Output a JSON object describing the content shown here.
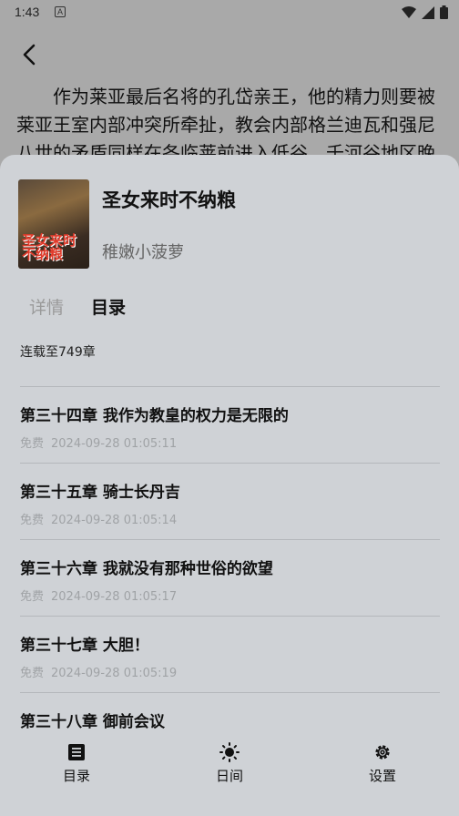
{
  "status": {
    "time": "1:43",
    "notif_letter": "A"
  },
  "reader": {
    "text": "作为莱亚最后名将的孔岱亲王，他的精力则要被莱亚王室内部冲突所牵扯，教会内部格兰迪瓦和强尼八世的矛盾同样在各临莱前进入低谷，千河谷地区晚"
  },
  "book": {
    "title": "圣女来时不纳粮",
    "author": "稚嫩小菠萝",
    "cover_text": "圣女来时不纳粮"
  },
  "tabs": [
    {
      "label": "详情",
      "active": false
    },
    {
      "label": "目录",
      "active": true
    }
  ],
  "serial_status": "连载至749章",
  "chapters": [
    {
      "title": "第三十四章 我作为教皇的权力是无限的",
      "free": "免费",
      "time": "2024-09-28 01:05:11"
    },
    {
      "title": "第三十五章 骑士长丹吉",
      "free": "免费",
      "time": "2024-09-28 01:05:14"
    },
    {
      "title": "第三十六章 我就没有那种世俗的欲望",
      "free": "免费",
      "time": "2024-09-28 01:05:17"
    },
    {
      "title": "第三十七章 大胆！",
      "free": "免费",
      "time": "2024-09-28 01:05:19"
    },
    {
      "title": "第三十八章 御前会议",
      "free": "",
      "time": ""
    }
  ],
  "nav": {
    "toc_label": "目录",
    "day_label": "日间",
    "settings_label": "设置"
  },
  "colors": {
    "sheet_bg": "#cfd2d6",
    "reader_bg": "#a9a9a9",
    "muted": "#a0a3a6"
  }
}
